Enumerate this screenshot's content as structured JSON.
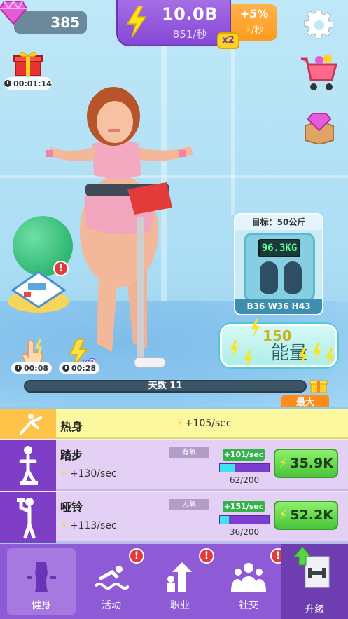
{
  "hud": {
    "gems": "385",
    "energy": "10.0B",
    "energy_rate": "851/秒",
    "boost_pct": "+5%",
    "boost_rate": "/秒",
    "multiplier": "x2",
    "gift_timer": "00:01:14"
  },
  "skills": [
    {
      "name": "tap",
      "timer": "00:08"
    },
    {
      "name": "x2",
      "label": "x2",
      "timer": "00:28"
    }
  ],
  "scale": {
    "target": "目标：50公斤",
    "display": "96.3KG",
    "measurements": "B36 W36 H43"
  },
  "energy_button": {
    "amount": "150",
    "label": "能量"
  },
  "day": {
    "label": "天数 11",
    "max_label": "最大"
  },
  "warmup": {
    "name": "热身",
    "rate": "+105/sec"
  },
  "exercises": [
    {
      "name": "踏步",
      "tag": "有氧",
      "rate": "+130/sec",
      "plus": "+101/sec",
      "progress": 0.31,
      "count": "62/200",
      "cost": "35.9K"
    },
    {
      "name": "哑铃",
      "tag": "无氧",
      "rate": "+113/sec",
      "plus": "+151/sec",
      "progress": 0.18,
      "count": "36/200",
      "cost": "52.2K"
    }
  ],
  "nav": {
    "fitness": "健身",
    "activity": "活动",
    "career": "职业",
    "social": "社交",
    "upgrade": "升级",
    "alert": "!"
  },
  "colors": {
    "accent_purple": "#8447d4",
    "energy_yellow": "#ffd21f",
    "buy_green": "#4ac53b",
    "max_orange": "#ff8c1a"
  }
}
